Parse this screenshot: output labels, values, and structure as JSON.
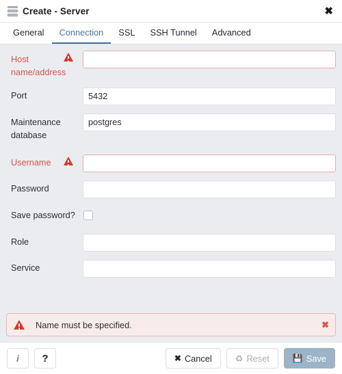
{
  "window": {
    "title": "Create - Server",
    "icon": "server-stack-icon",
    "close_label": "✖"
  },
  "tabs": [
    {
      "label": "General",
      "active": false
    },
    {
      "label": "Connection",
      "active": true
    },
    {
      "label": "SSL",
      "active": false
    },
    {
      "label": "SSH Tunnel",
      "active": false
    },
    {
      "label": "Advanced",
      "active": false
    }
  ],
  "form": {
    "fields": [
      {
        "label": "Host name/address",
        "type": "text",
        "value": "",
        "placeholder": "",
        "invalid": true,
        "warning_icon": "warning-triangle-icon",
        "name": "host-name-address"
      },
      {
        "label": "Port",
        "type": "text",
        "value": "5432",
        "placeholder": "",
        "invalid": false,
        "warning_icon": "",
        "name": "port"
      },
      {
        "label": "Maintenance database",
        "type": "text",
        "value": "postgres",
        "placeholder": "",
        "invalid": false,
        "warning_icon": "",
        "name": "maintenance-database"
      },
      {
        "label": "Username",
        "type": "text",
        "value": "",
        "placeholder": "",
        "invalid": true,
        "warning_icon": "warning-triangle-icon",
        "name": "username"
      },
      {
        "label": "Password",
        "type": "password",
        "value": "",
        "placeholder": "",
        "invalid": false,
        "warning_icon": "",
        "name": "password"
      },
      {
        "label": "Save password?",
        "type": "checkbox",
        "checked": false,
        "invalid": false,
        "warning_icon": "",
        "name": "save-password"
      },
      {
        "label": "Role",
        "type": "text",
        "value": "",
        "placeholder": "",
        "invalid": false,
        "warning_icon": "",
        "name": "role"
      },
      {
        "label": "Service",
        "type": "text",
        "value": "",
        "placeholder": "",
        "invalid": false,
        "warning_icon": "",
        "name": "service"
      }
    ]
  },
  "alert": {
    "icon": "warning-triangle-icon",
    "message": "Name must be specified.",
    "dismiss_label": "✖"
  },
  "footer": {
    "info_label": "i",
    "help_label": "?",
    "cancel_label": "Cancel",
    "cancel_icon": "✖",
    "reset_label": "Reset",
    "reset_icon": "♻",
    "save_label": "Save",
    "save_icon": "💾"
  },
  "colors": {
    "accent": "#476b91",
    "error": "#d9534f",
    "warning_triangle": "#d9362b",
    "form_bg": "#eaecf0",
    "save_disabled": "#9db3c6"
  }
}
